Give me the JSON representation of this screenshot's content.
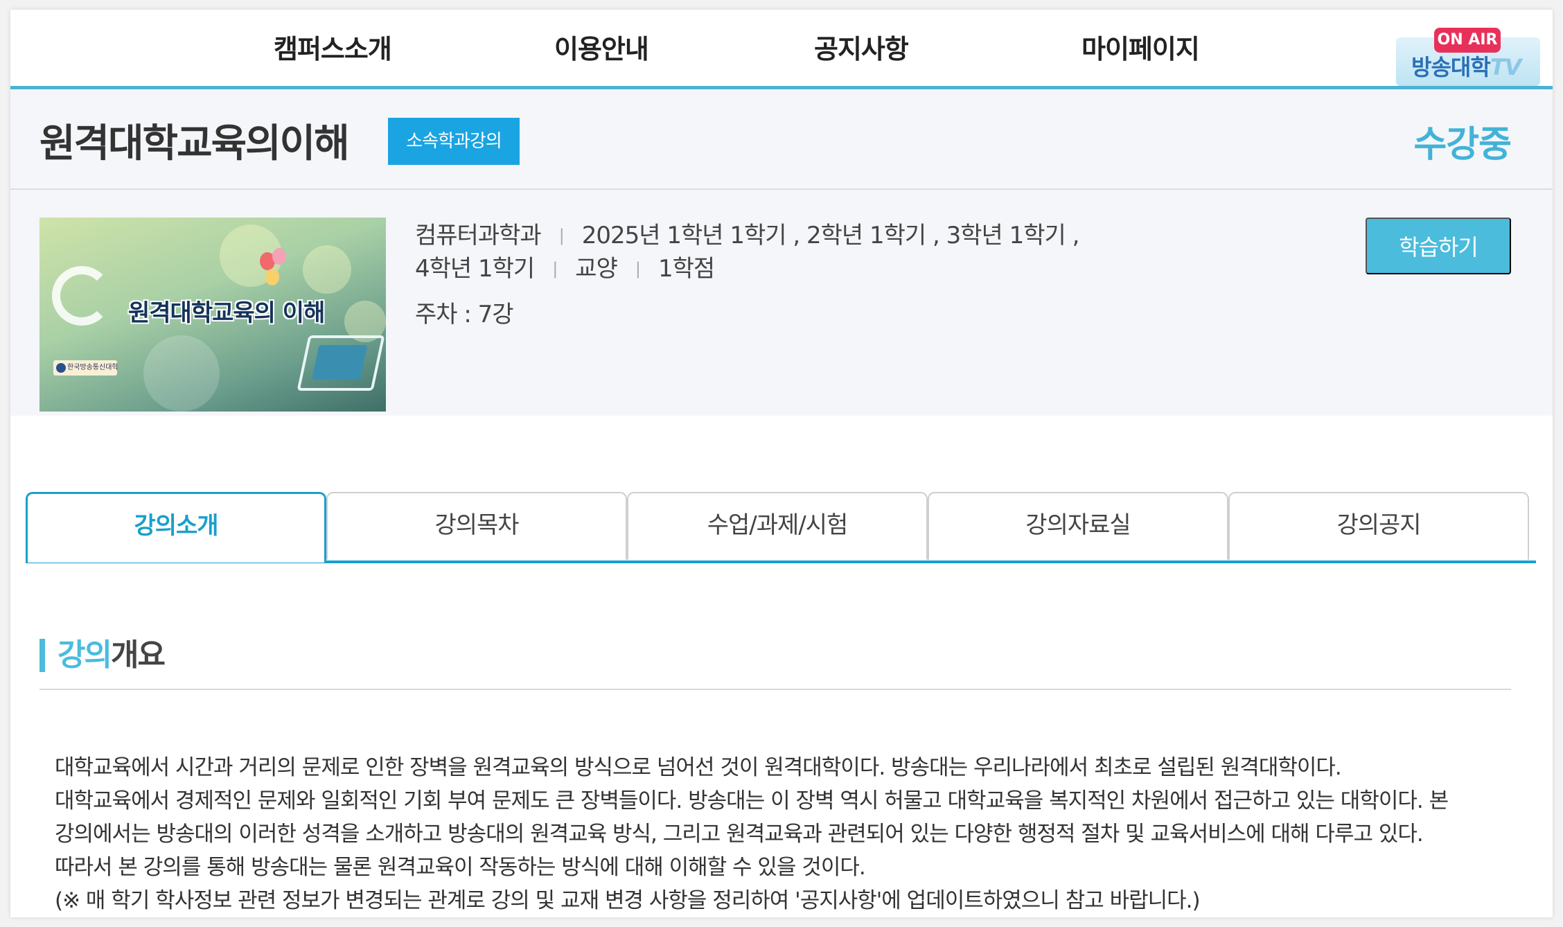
{
  "nav": {
    "items": [
      "캠퍼스소개",
      "이용안내",
      "공지사항",
      "마이페이지"
    ],
    "onair_badge": "ON AIR",
    "onair_logo": "방송대학",
    "onair_logo_tv": "TV"
  },
  "course": {
    "title": "원격대학교육의이해",
    "category_badge": "소속학과강의",
    "status": "수강중",
    "thumbnail_title": "원격대학교육의 이해",
    "thumbnail_logo": "한국방송통신대학교",
    "department": "컴퓨터과학과",
    "terms_line1": "2025년  1학년 1학기 , 2학년 1학기 , 3학년 1학기 ,",
    "terms_line2": "4학년 1학기",
    "type": "교양",
    "credits": "1학점",
    "weeks": "주차 : 7강",
    "study_button": "학습하기"
  },
  "tabs": [
    {
      "label": "강의소개",
      "active": true
    },
    {
      "label": "강의목차",
      "active": false
    },
    {
      "label": "수업/과제/시험",
      "active": false
    },
    {
      "label": "강의자료실",
      "active": false
    },
    {
      "label": "강의공지",
      "active": false
    }
  ],
  "overview": {
    "title_highlight": "강의",
    "title_rest": "개요",
    "paragraphs": [
      "대학교육에서 시간과 거리의 문제로 인한 장벽을 원격교육의 방식으로 넘어선 것이 원격대학이다. 방송대는 우리나라에서 최초로 설립된 원격대학이다.",
      "대학교육에서 경제적인 문제와 일회적인 기회 부여 문제도 큰 장벽들이다. 방송대는 이 장벽 역시 허물고 대학교육을 복지적인 차원에서 접근하고 있는 대학이다. 본",
      "강의에서는 방송대의 이러한 성격을 소개하고 방송대의 원격교육 방식, 그리고 원격교육과 관련되어 있는 다양한 행정적 절차 및 교육서비스에 대해 다루고 있다.",
      "따라서 본 강의를 통해 방송대는 물론 원격교육이 작동하는 방식에 대해 이해할 수 있을 것이다.",
      "(※ 매 학기 학사정보 관련 정보가 변경되는 관계로 강의 및 교재 변경 사항을 정리하여 '공지사항'에 업데이트하였으니 참고 바랍니다.)"
    ]
  },
  "colors": {
    "accent": "#4bbcdc",
    "tab_active": "#1a9fcc",
    "badge": "#1aa4e2",
    "onair": "#e8315a"
  }
}
